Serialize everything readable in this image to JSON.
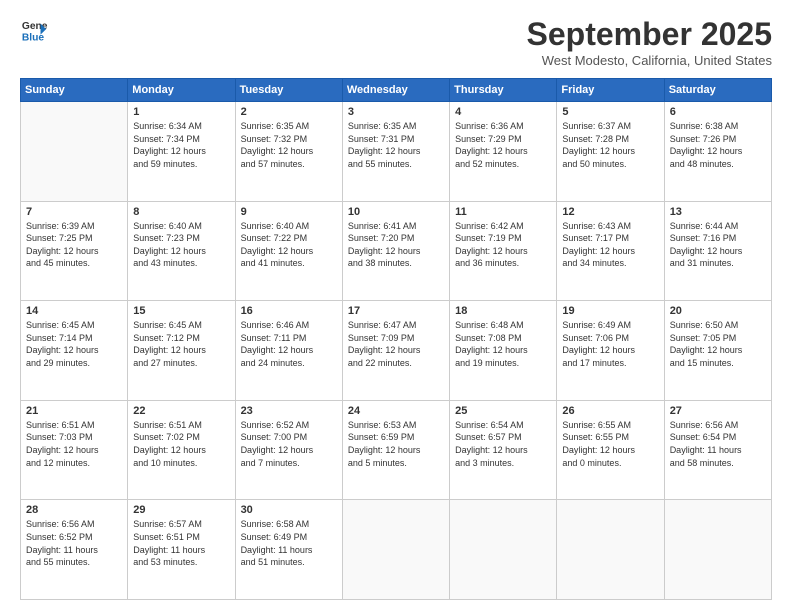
{
  "logo": {
    "line1": "General",
    "line2": "Blue"
  },
  "title": "September 2025",
  "location": "West Modesto, California, United States",
  "days_of_week": [
    "Sunday",
    "Monday",
    "Tuesday",
    "Wednesday",
    "Thursday",
    "Friday",
    "Saturday"
  ],
  "weeks": [
    [
      {
        "day": "",
        "info": ""
      },
      {
        "day": "1",
        "info": "Sunrise: 6:34 AM\nSunset: 7:34 PM\nDaylight: 12 hours\nand 59 minutes."
      },
      {
        "day": "2",
        "info": "Sunrise: 6:35 AM\nSunset: 7:32 PM\nDaylight: 12 hours\nand 57 minutes."
      },
      {
        "day": "3",
        "info": "Sunrise: 6:35 AM\nSunset: 7:31 PM\nDaylight: 12 hours\nand 55 minutes."
      },
      {
        "day": "4",
        "info": "Sunrise: 6:36 AM\nSunset: 7:29 PM\nDaylight: 12 hours\nand 52 minutes."
      },
      {
        "day": "5",
        "info": "Sunrise: 6:37 AM\nSunset: 7:28 PM\nDaylight: 12 hours\nand 50 minutes."
      },
      {
        "day": "6",
        "info": "Sunrise: 6:38 AM\nSunset: 7:26 PM\nDaylight: 12 hours\nand 48 minutes."
      }
    ],
    [
      {
        "day": "7",
        "info": "Sunrise: 6:39 AM\nSunset: 7:25 PM\nDaylight: 12 hours\nand 45 minutes."
      },
      {
        "day": "8",
        "info": "Sunrise: 6:40 AM\nSunset: 7:23 PM\nDaylight: 12 hours\nand 43 minutes."
      },
      {
        "day": "9",
        "info": "Sunrise: 6:40 AM\nSunset: 7:22 PM\nDaylight: 12 hours\nand 41 minutes."
      },
      {
        "day": "10",
        "info": "Sunrise: 6:41 AM\nSunset: 7:20 PM\nDaylight: 12 hours\nand 38 minutes."
      },
      {
        "day": "11",
        "info": "Sunrise: 6:42 AM\nSunset: 7:19 PM\nDaylight: 12 hours\nand 36 minutes."
      },
      {
        "day": "12",
        "info": "Sunrise: 6:43 AM\nSunset: 7:17 PM\nDaylight: 12 hours\nand 34 minutes."
      },
      {
        "day": "13",
        "info": "Sunrise: 6:44 AM\nSunset: 7:16 PM\nDaylight: 12 hours\nand 31 minutes."
      }
    ],
    [
      {
        "day": "14",
        "info": "Sunrise: 6:45 AM\nSunset: 7:14 PM\nDaylight: 12 hours\nand 29 minutes."
      },
      {
        "day": "15",
        "info": "Sunrise: 6:45 AM\nSunset: 7:12 PM\nDaylight: 12 hours\nand 27 minutes."
      },
      {
        "day": "16",
        "info": "Sunrise: 6:46 AM\nSunset: 7:11 PM\nDaylight: 12 hours\nand 24 minutes."
      },
      {
        "day": "17",
        "info": "Sunrise: 6:47 AM\nSunset: 7:09 PM\nDaylight: 12 hours\nand 22 minutes."
      },
      {
        "day": "18",
        "info": "Sunrise: 6:48 AM\nSunset: 7:08 PM\nDaylight: 12 hours\nand 19 minutes."
      },
      {
        "day": "19",
        "info": "Sunrise: 6:49 AM\nSunset: 7:06 PM\nDaylight: 12 hours\nand 17 minutes."
      },
      {
        "day": "20",
        "info": "Sunrise: 6:50 AM\nSunset: 7:05 PM\nDaylight: 12 hours\nand 15 minutes."
      }
    ],
    [
      {
        "day": "21",
        "info": "Sunrise: 6:51 AM\nSunset: 7:03 PM\nDaylight: 12 hours\nand 12 minutes."
      },
      {
        "day": "22",
        "info": "Sunrise: 6:51 AM\nSunset: 7:02 PM\nDaylight: 12 hours\nand 10 minutes."
      },
      {
        "day": "23",
        "info": "Sunrise: 6:52 AM\nSunset: 7:00 PM\nDaylight: 12 hours\nand 7 minutes."
      },
      {
        "day": "24",
        "info": "Sunrise: 6:53 AM\nSunset: 6:59 PM\nDaylight: 12 hours\nand 5 minutes."
      },
      {
        "day": "25",
        "info": "Sunrise: 6:54 AM\nSunset: 6:57 PM\nDaylight: 12 hours\nand 3 minutes."
      },
      {
        "day": "26",
        "info": "Sunrise: 6:55 AM\nSunset: 6:55 PM\nDaylight: 12 hours\nand 0 minutes."
      },
      {
        "day": "27",
        "info": "Sunrise: 6:56 AM\nSunset: 6:54 PM\nDaylight: 11 hours\nand 58 minutes."
      }
    ],
    [
      {
        "day": "28",
        "info": "Sunrise: 6:56 AM\nSunset: 6:52 PM\nDaylight: 11 hours\nand 55 minutes."
      },
      {
        "day": "29",
        "info": "Sunrise: 6:57 AM\nSunset: 6:51 PM\nDaylight: 11 hours\nand 53 minutes."
      },
      {
        "day": "30",
        "info": "Sunrise: 6:58 AM\nSunset: 6:49 PM\nDaylight: 11 hours\nand 51 minutes."
      },
      {
        "day": "",
        "info": ""
      },
      {
        "day": "",
        "info": ""
      },
      {
        "day": "",
        "info": ""
      },
      {
        "day": "",
        "info": ""
      }
    ]
  ]
}
